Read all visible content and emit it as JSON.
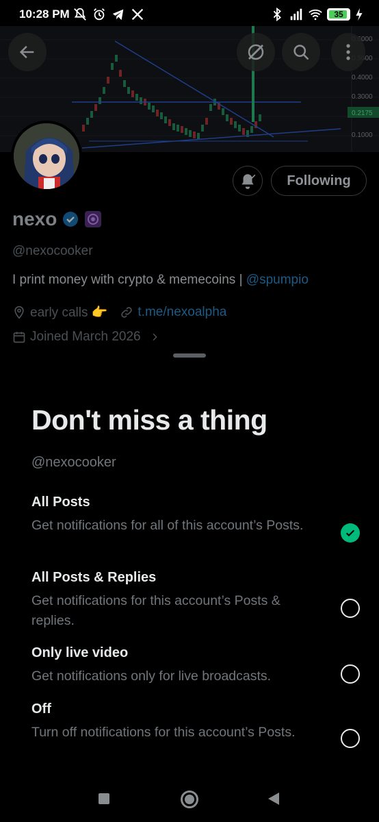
{
  "status_bar": {
    "time": "10:28 PM",
    "battery": "35"
  },
  "chart_axis": {
    "labels": [
      "0.6000",
      "0.5000",
      "0.4000",
      "0.3000",
      "0.2175",
      "0.1000"
    ],
    "current_price": "0.2175"
  },
  "profile": {
    "name": "nexo",
    "handle": "@nexocooker",
    "bio_text": "I print money with crypto & memecoins | ",
    "bio_mention": "@spumpio",
    "location": "early calls 👉",
    "link": "t.me/nexoalpha",
    "joined": "Joined March 2026",
    "following_label": "Following"
  },
  "sheet": {
    "title": "Don't miss a thing",
    "handle": "@nexocooker",
    "options": [
      {
        "title": "All Posts",
        "desc": "Get notifications for all of this account’s Posts.",
        "selected": true
      },
      {
        "title": "All Posts & Replies",
        "desc": "Get notifications for this account’s Posts & replies.",
        "selected": false
      },
      {
        "title": "Only live video",
        "desc": "Get notifications only for live broadcasts.",
        "selected": false
      },
      {
        "title": "Off",
        "desc": "Turn off notifications for this account’s Posts.",
        "selected": false
      }
    ]
  },
  "colors": {
    "accent_green": "#00ba7c",
    "link_blue": "#1d9bf0",
    "verified_blue": "#1d9bf0"
  }
}
